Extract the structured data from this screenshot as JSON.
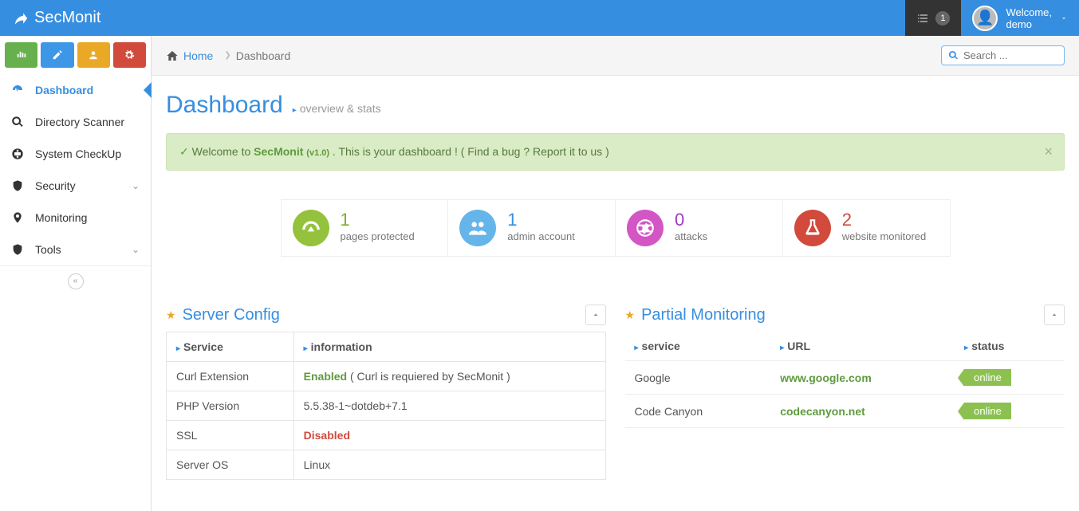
{
  "brand": "SecMonit",
  "topbar": {
    "notif_count": "1",
    "welcome": "Welcome,",
    "username": "demo"
  },
  "breadcrumb": {
    "home": "Home",
    "current": "Dashboard"
  },
  "search": {
    "placeholder": "Search ..."
  },
  "page": {
    "title": "Dashboard",
    "subtitle": "overview & stats"
  },
  "alert": {
    "pre": "Welcome to ",
    "brand": "SecMonit ",
    "ver": "(v1.0)",
    "post": " . This is your dashboard ! ( Find a bug ? Report it to us )"
  },
  "sidebar": [
    {
      "label": "Dashboard"
    },
    {
      "label": "Directory Scanner"
    },
    {
      "label": "System CheckUp"
    },
    {
      "label": "Security"
    },
    {
      "label": "Monitoring"
    },
    {
      "label": "Tools"
    }
  ],
  "stats": [
    {
      "value": "1",
      "label": "pages protected"
    },
    {
      "value": "1",
      "label": "admin account"
    },
    {
      "value": "0",
      "label": "attacks"
    },
    {
      "value": "2",
      "label": "website monitored"
    }
  ],
  "panel1": {
    "title": "Server Config",
    "h1": "Service",
    "h2": "information",
    "rows": [
      {
        "service": "Curl Extension",
        "info_pre": "Enabled",
        "info_post": " ( Curl is requiered by SecMonit )",
        "cls": "enabled"
      },
      {
        "service": "PHP Version",
        "info_pre": "5.5.38-1~dotdeb+7.1",
        "info_post": "",
        "cls": ""
      },
      {
        "service": "SSL",
        "info_pre": "Disabled",
        "info_post": "",
        "cls": "disabled"
      },
      {
        "service": "Server OS",
        "info_pre": "Linux",
        "info_post": "",
        "cls": ""
      }
    ]
  },
  "panel2": {
    "title": "Partial Monitoring",
    "h1": "service",
    "h2": "URL",
    "h3": "status",
    "rows": [
      {
        "service": "Google",
        "url": "www.google.com",
        "status": "online"
      },
      {
        "service": "Code Canyon",
        "url": "codecanyon.net",
        "status": "online"
      }
    ]
  }
}
